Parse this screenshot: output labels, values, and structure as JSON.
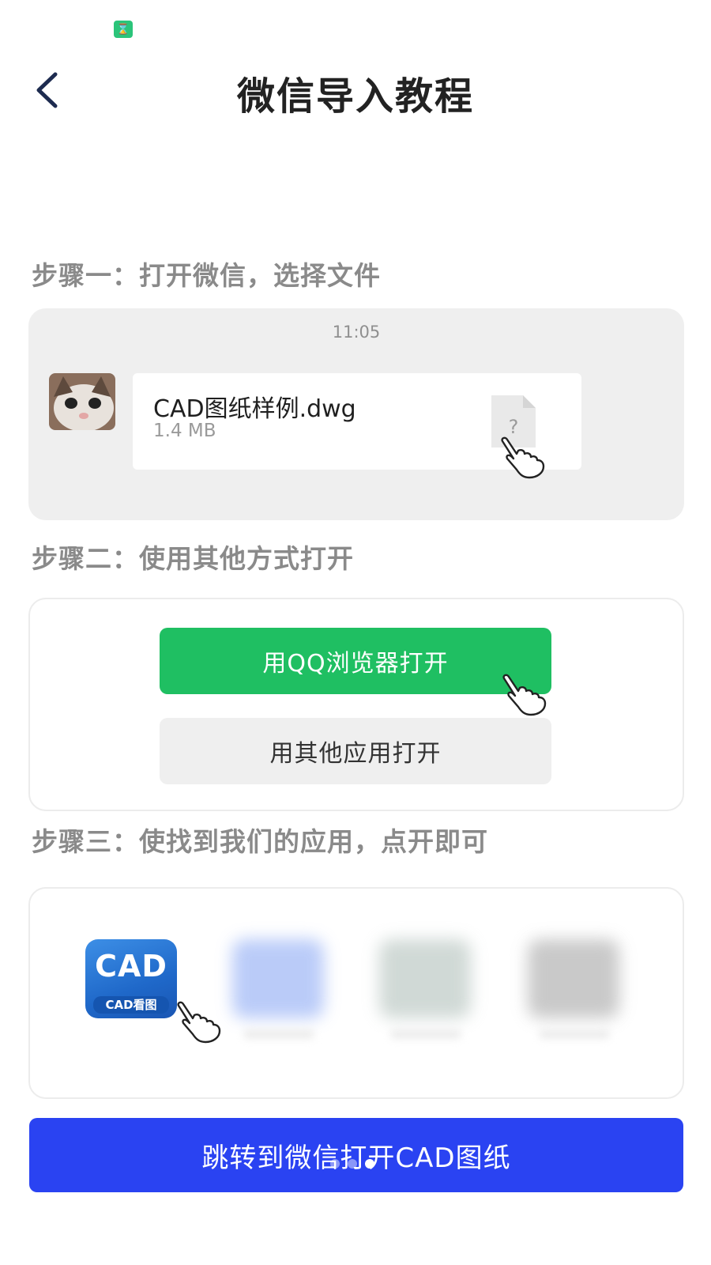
{
  "header": {
    "title": "微信导入教程",
    "back_icon": "chevron-left-icon"
  },
  "status_bar": {
    "notification_icon": "hourglass-icon"
  },
  "step1": {
    "heading": "步骤一：打开微信，选择文件",
    "chat_time": "11:05",
    "file_name": "CAD图纸样例.dwg",
    "file_size": "1.4 MB",
    "file_icon_glyph": "?"
  },
  "step2": {
    "heading": "步骤二：使用其他方式打开",
    "primary_option": "用QQ浏览器打开",
    "secondary_option": "用其他应用打开"
  },
  "step3": {
    "heading": "步骤三：使找到我们的应用，点开即可",
    "app_logo_text": "CAD",
    "app_logo_subtext": "CAD看图"
  },
  "footer": {
    "button_label": "跳转到微信打开CAD图纸",
    "carousel": {
      "total": 3,
      "active_index": 2
    }
  },
  "colors": {
    "wechat_green": "#1fbf62",
    "primary_blue": "#2a43f2",
    "step_heading_gray": "#8a8a8a"
  }
}
